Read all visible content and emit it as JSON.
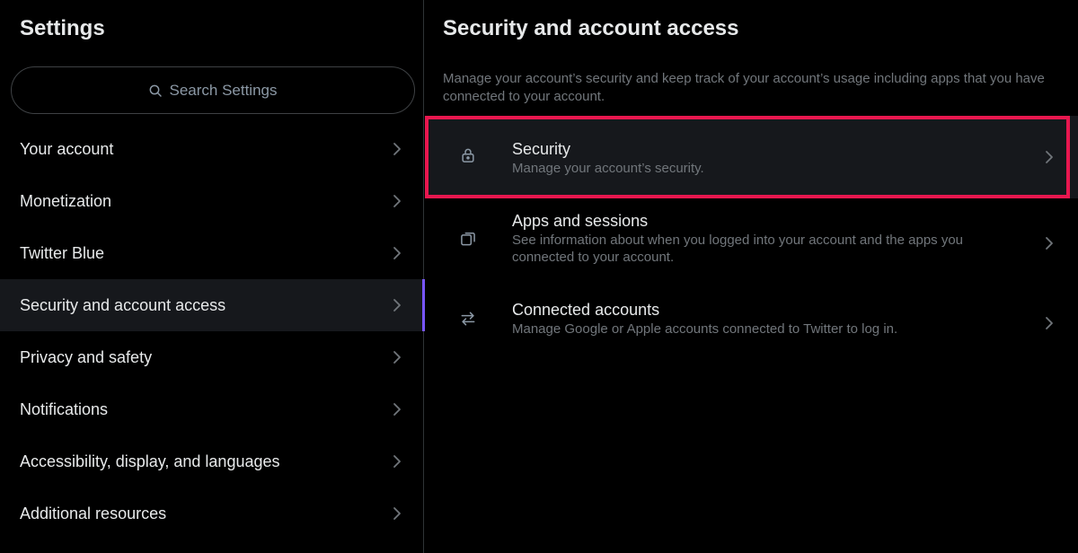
{
  "sidebar": {
    "title": "Settings",
    "search_placeholder": "Search Settings",
    "items": [
      {
        "label": "Your account"
      },
      {
        "label": "Monetization"
      },
      {
        "label": "Twitter Blue"
      },
      {
        "label": "Security and account access"
      },
      {
        "label": "Privacy and safety"
      },
      {
        "label": "Notifications"
      },
      {
        "label": "Accessibility, display, and languages"
      },
      {
        "label": "Additional resources"
      }
    ],
    "active_item": "Security and account access"
  },
  "main": {
    "title": "Security and account access",
    "description": "Manage your account’s security and keep track of your account’s usage including apps that you have connected to your account.",
    "options": [
      {
        "title": "Security",
        "subtitle": "Manage your account’s security.",
        "icon": "lock-icon"
      },
      {
        "title": "Apps and sessions",
        "subtitle": "See information about when you logged into your account and the apps you connected to your account.",
        "icon": "copy-icon"
      },
      {
        "title": "Connected accounts",
        "subtitle": "Manage Google or Apple accounts connected to Twitter to log in.",
        "icon": "swap-arrows-icon"
      }
    ]
  },
  "colors": {
    "background": "#000000",
    "active_background": "#16181c",
    "active_indicator": "#7856ff",
    "highlight_border": "#e8174f",
    "text_primary": "#e7e9ea",
    "text_secondary": "#71767b"
  }
}
